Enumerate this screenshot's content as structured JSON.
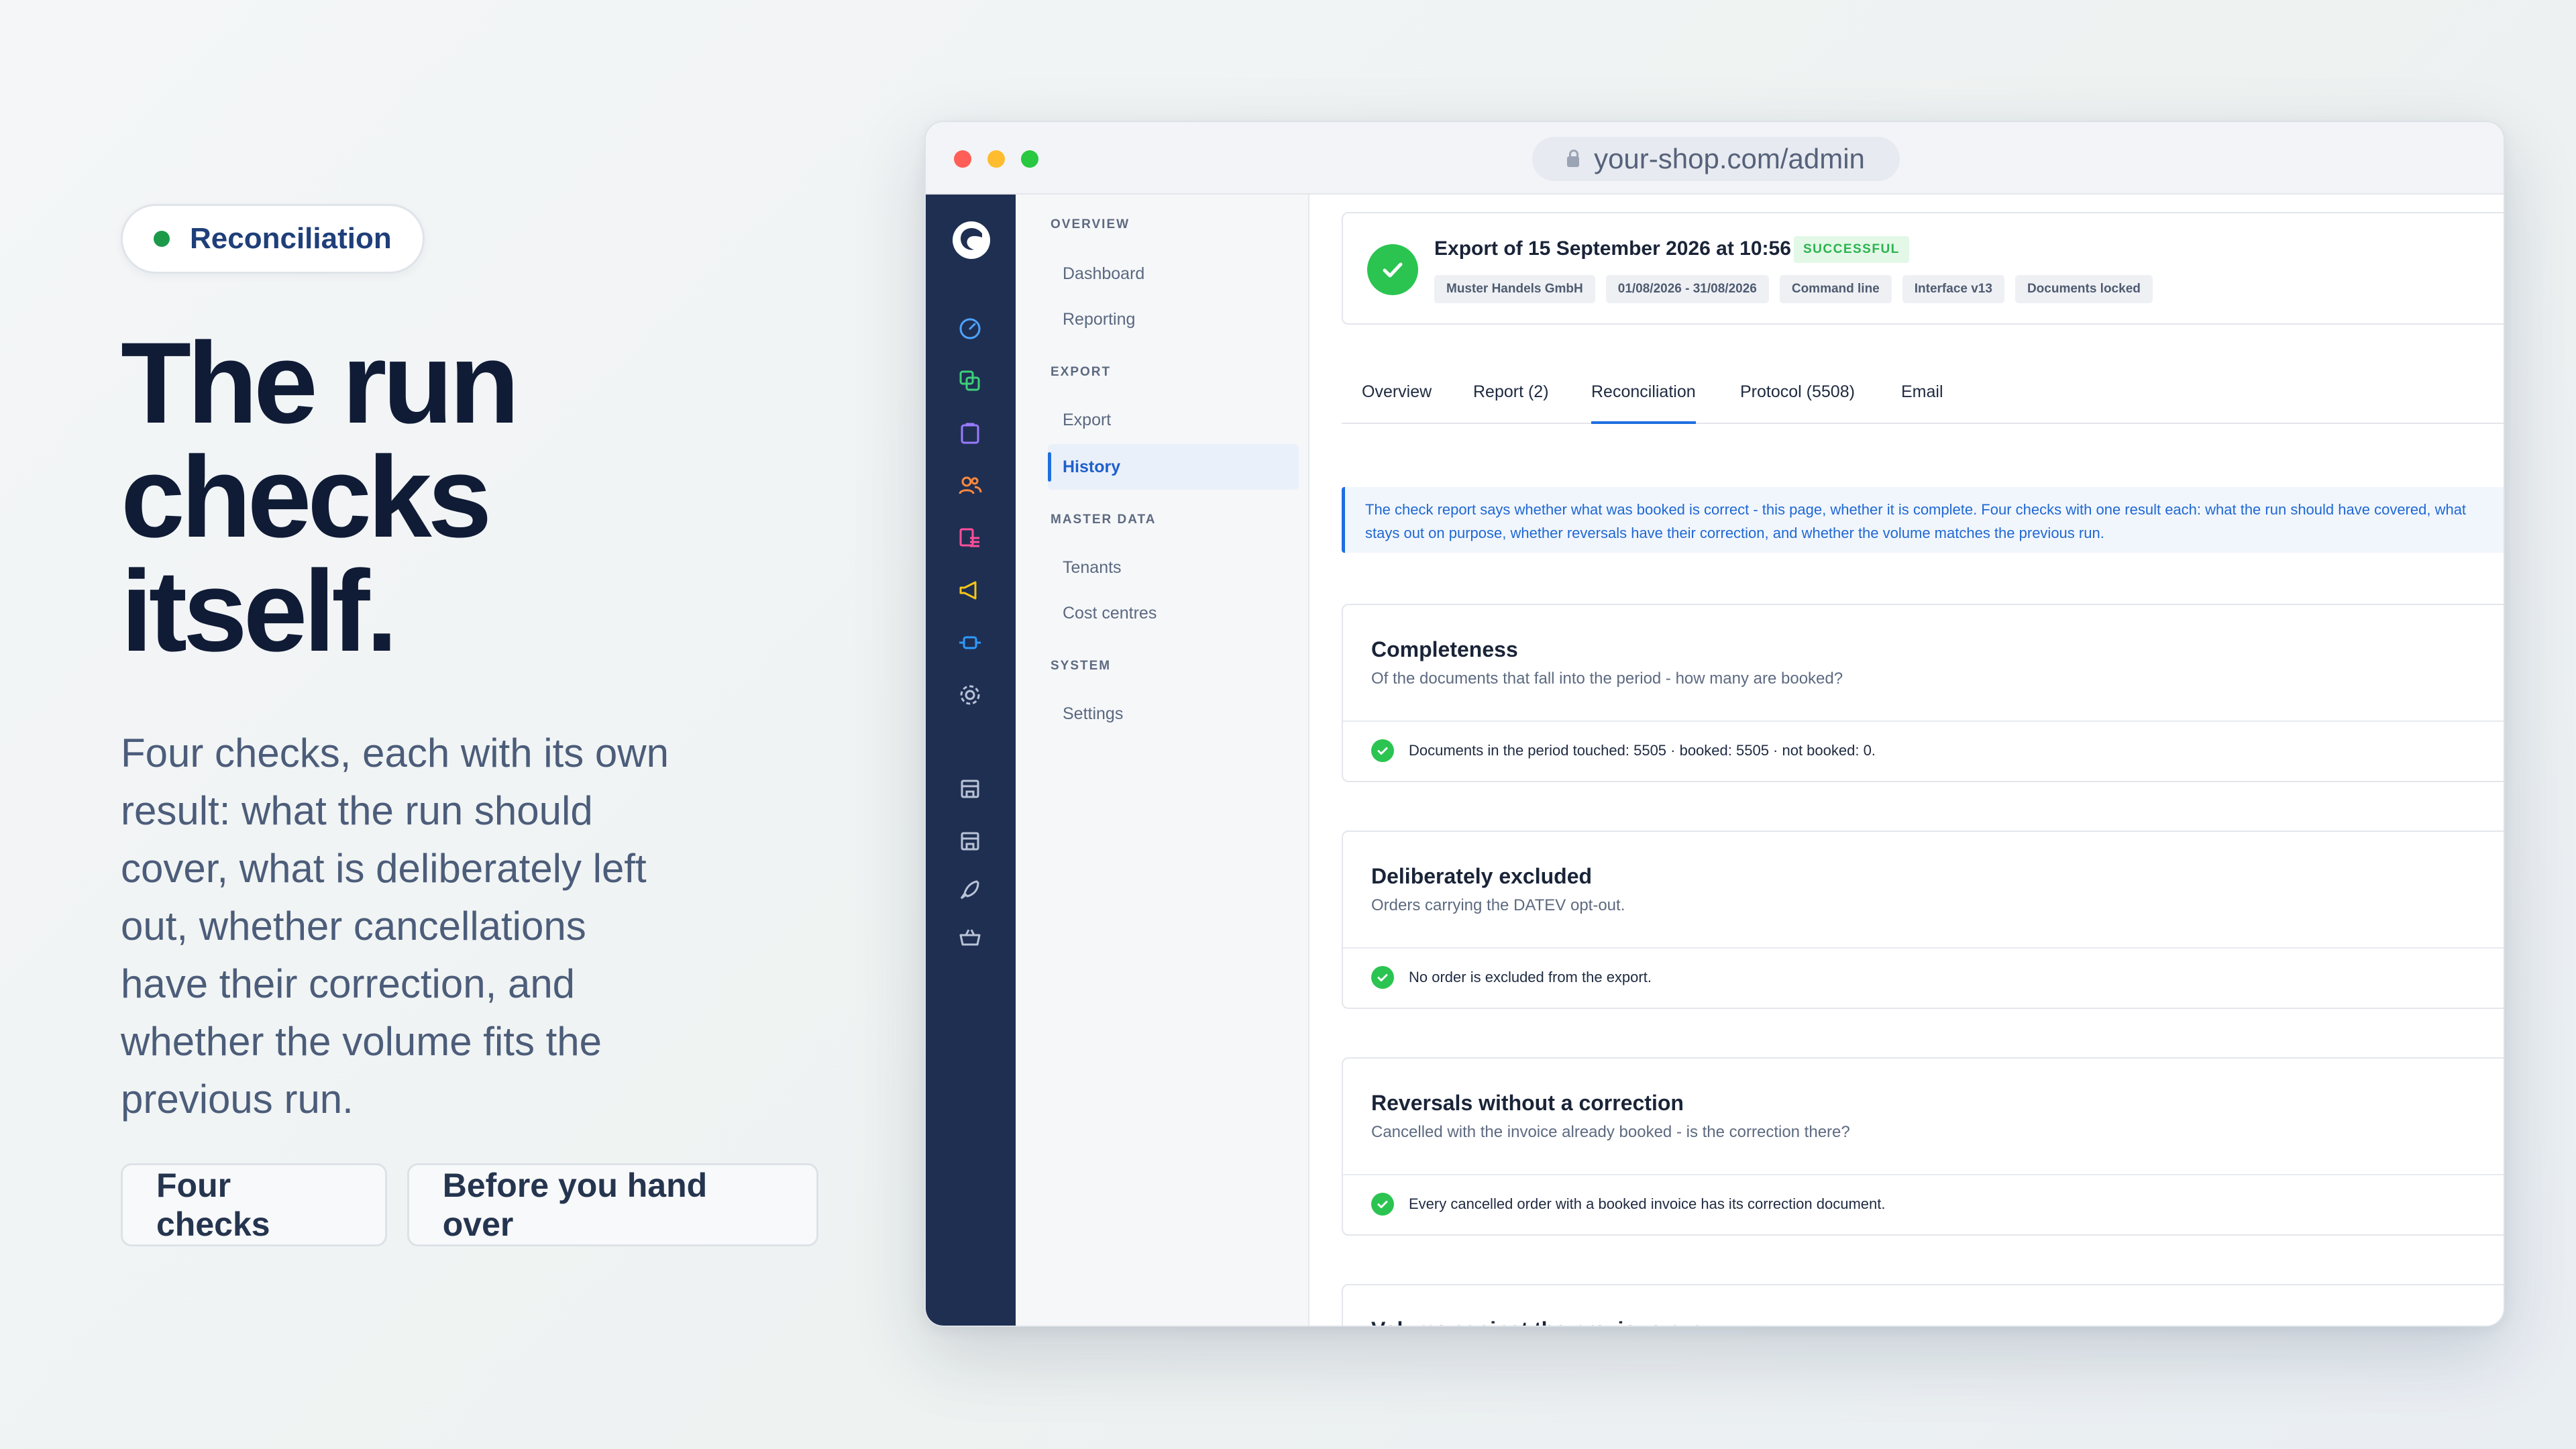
{
  "hero": {
    "badge_label": "Reconciliation",
    "headline": "The run\nchecks\nitself.",
    "lede": "Four checks, each with its own result: what the run should cover, what is deliberately left out, whether cancellations have their correction, and whether the volume fits the previous run.",
    "chips": [
      "Four checks",
      "Before you hand over"
    ]
  },
  "browser": {
    "url": "your-shop.com/admin"
  },
  "rail": {
    "icons": [
      "logo-icon",
      "dashboard-gauge-icon",
      "copy-icon",
      "clipboard-icon",
      "users-icon",
      "list-icon",
      "megaphone-icon",
      "plug-icon",
      "gear-icon",
      "store-icon",
      "store-icon",
      "rocket-icon",
      "basket-icon"
    ]
  },
  "nav": {
    "sections": [
      {
        "title": "OVERVIEW",
        "items": [
          "Dashboard",
          "Reporting"
        ]
      },
      {
        "title": "EXPORT",
        "items": [
          "Export",
          "History"
        ]
      },
      {
        "title": "MASTER DATA",
        "items": [
          "Tenants",
          "Cost centres"
        ]
      },
      {
        "title": "SYSTEM",
        "items": [
          "Settings"
        ]
      }
    ],
    "active_item": "History"
  },
  "export": {
    "title": "Export of 15 September 2026 at 10:56",
    "status": "SUCCESSFUL",
    "tags": [
      "Muster Handels GmbH",
      "01/08/2026 - 31/08/2026",
      "Command line",
      "Interface v13",
      "Documents locked"
    ]
  },
  "tabs": {
    "items": [
      "Overview",
      "Report (2)",
      "Reconciliation",
      "Protocol (5508)",
      "Email"
    ],
    "active": "Reconciliation"
  },
  "info": {
    "text": "The check report says whether what was booked is correct - this page, whether it is complete. Four checks with one result each: what the run should have covered, what stays out on purpose, whether reversals have their correction, and whether the volume matches the previous run."
  },
  "checks": [
    {
      "title": "Completeness",
      "subtitle": "Of the documents that fall into the period - how many are booked?",
      "result": "Documents in the period touched: 5505 · booked: 5505 · not booked: 0."
    },
    {
      "title": "Deliberately excluded",
      "subtitle": "Orders carrying the DATEV opt-out.",
      "result": "No order is excluded from the export."
    },
    {
      "title": "Reversals without a correction",
      "subtitle": "Cancelled with the invoice already booked - is the correction there?",
      "result": "Every cancelled order with a booked invoice has its correction document."
    },
    {
      "title": "Volume against the previous run",
      "subtitle": "",
      "result": ""
    }
  ],
  "colors": {
    "accent": "#1f6fe0",
    "success": "#2bc451",
    "rail": "#1f2f52",
    "headline": "#101c36"
  }
}
